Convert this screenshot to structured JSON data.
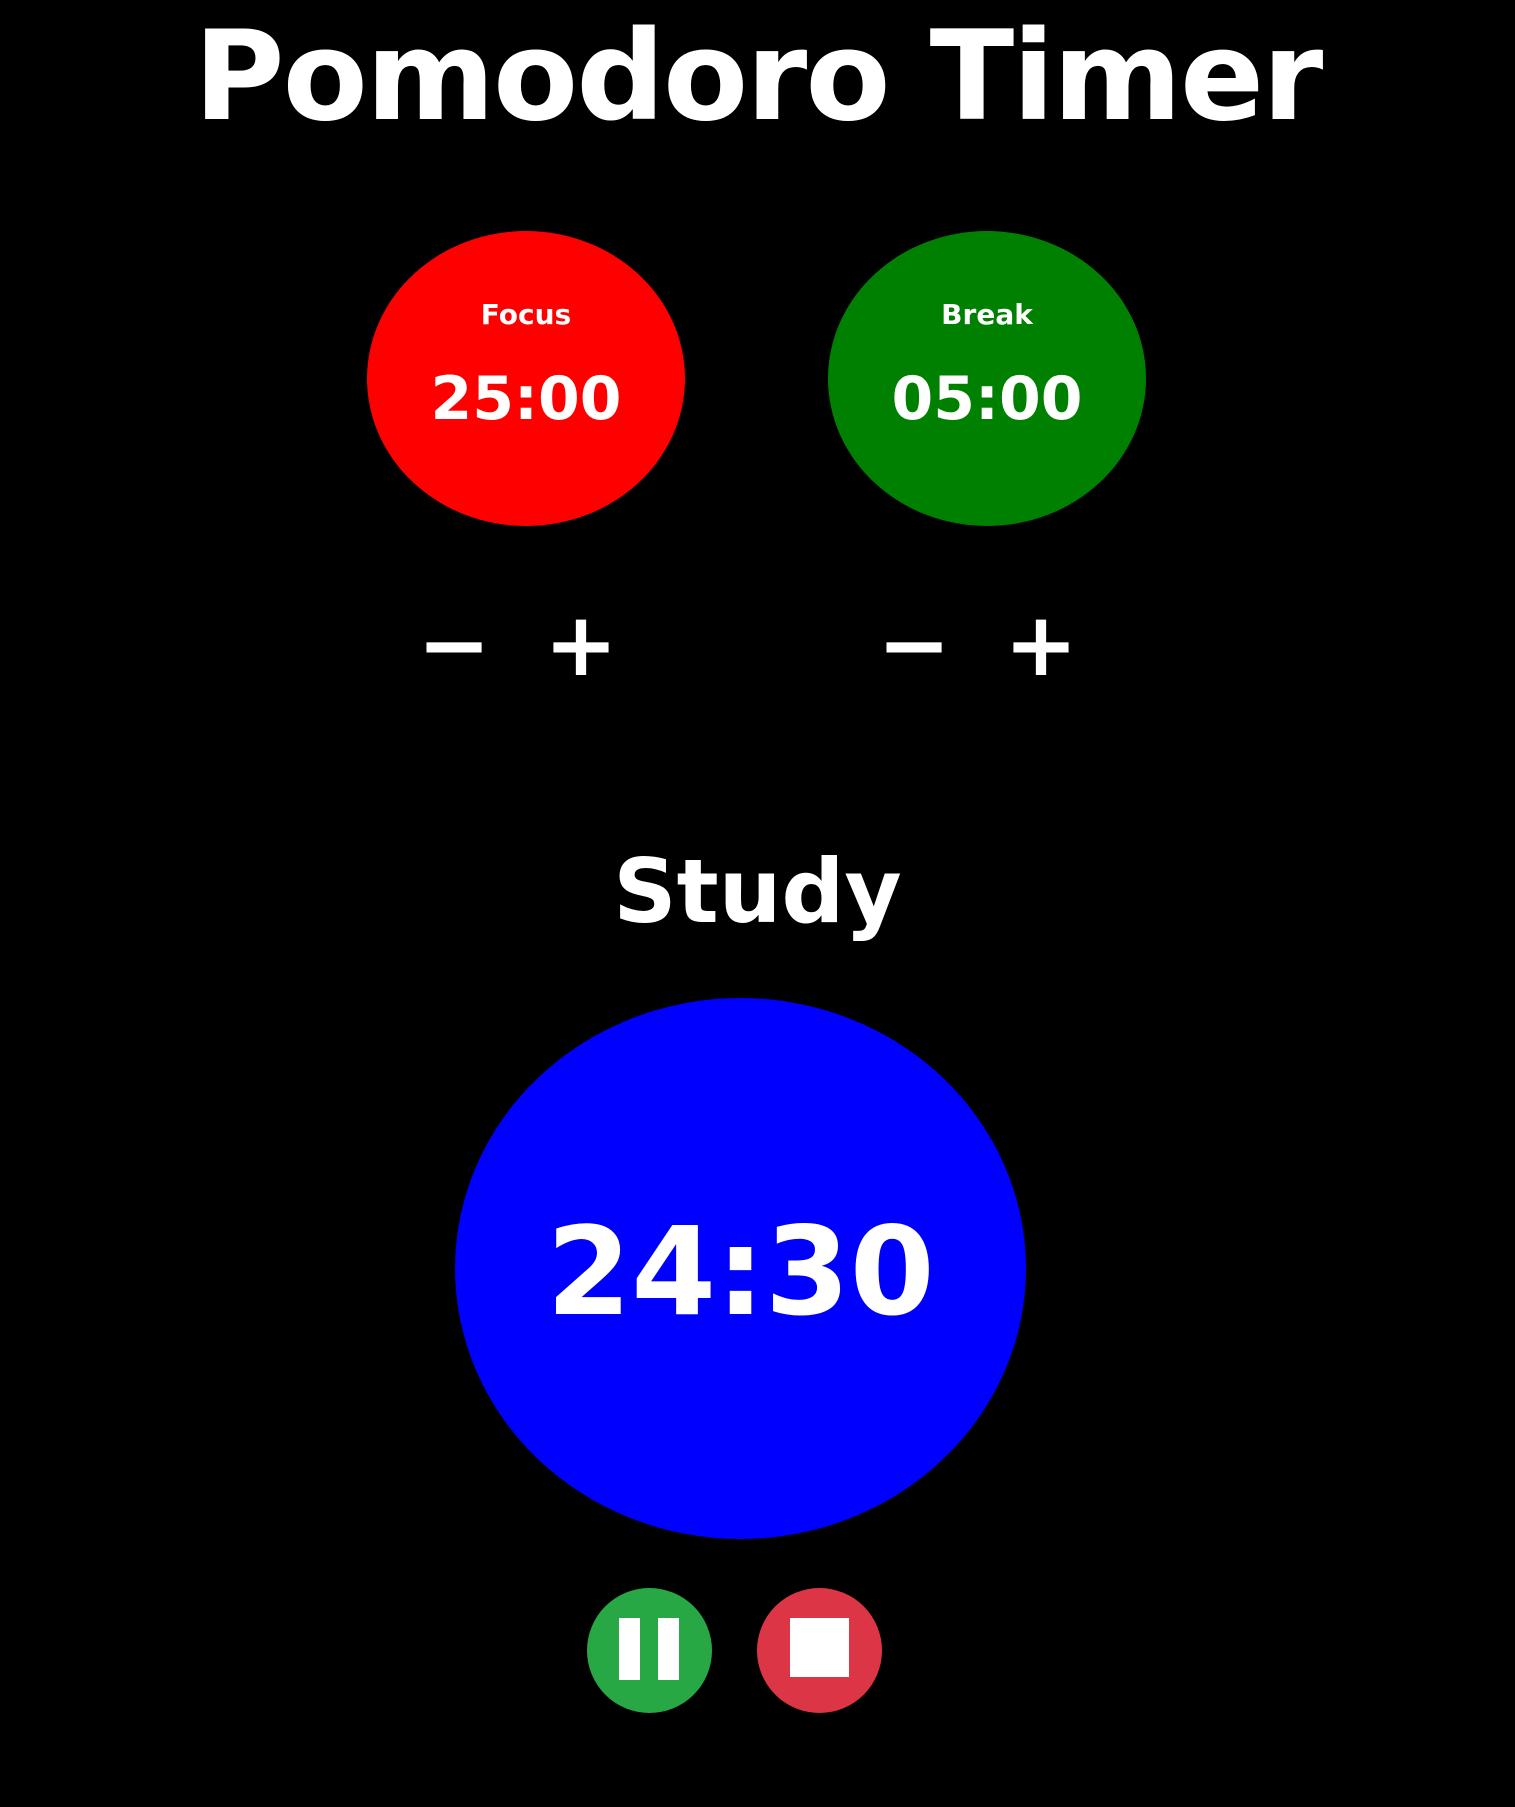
{
  "app": {
    "title": "Pomodoro Timer"
  },
  "settings": {
    "focus": {
      "label": "Focus",
      "value": "25:00",
      "color": "#ff0000",
      "decrement_label": "−",
      "increment_label": "+"
    },
    "break": {
      "label": "Break",
      "value": "05:00",
      "color": "#008000",
      "decrement_label": "−",
      "increment_label": "+"
    }
  },
  "session": {
    "label": "Study",
    "remaining": "24:30",
    "color": "#0000ff"
  },
  "controls": {
    "pause": {
      "icon": "pause-icon",
      "color": "#28a745"
    },
    "stop": {
      "icon": "stop-icon",
      "color": "#dc3545"
    }
  },
  "colors": {
    "background": "#000000",
    "text": "#ffffff"
  }
}
